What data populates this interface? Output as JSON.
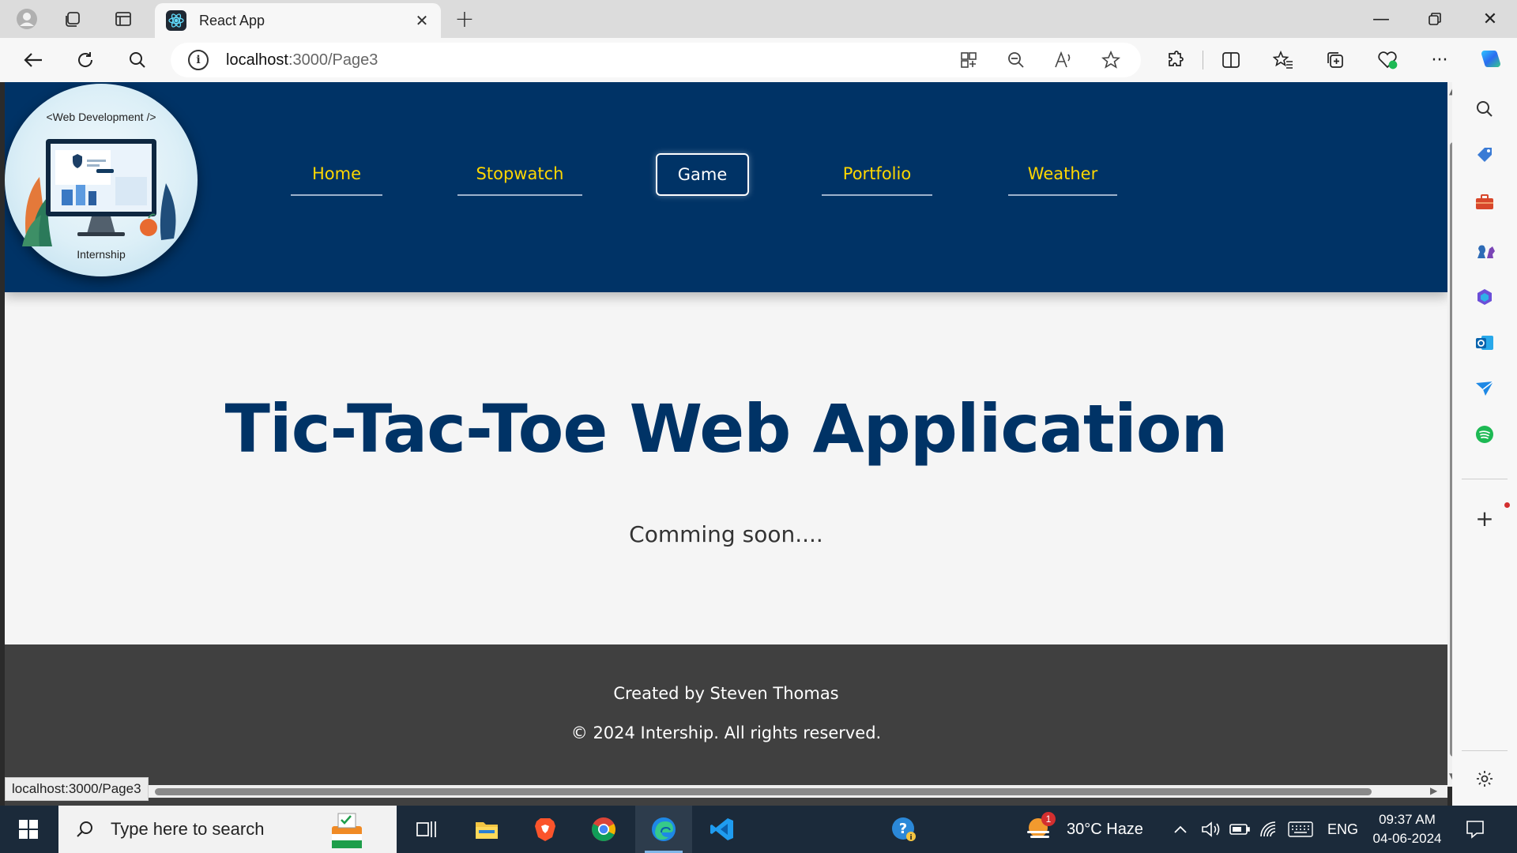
{
  "browser": {
    "tab_title": "React App",
    "url_host": "localhost",
    "url_path": ":3000/Page3",
    "status_url": "localhost:3000/Page3"
  },
  "site": {
    "logo_top_text": "<Web Development />",
    "logo_bottom_text": "Internship",
    "nav": [
      {
        "label": "Home",
        "active": false
      },
      {
        "label": "Stopwatch",
        "active": false
      },
      {
        "label": "Game",
        "active": true
      },
      {
        "label": "Portfolio",
        "active": false
      },
      {
        "label": "Weather",
        "active": false
      }
    ],
    "title": "Tic-Tac-Toe Web Application",
    "subtitle": "Comming soon....",
    "footer": {
      "created_by": "Created by Steven Thomas",
      "copyright": "© 2024 Intership. All rights reserved."
    }
  },
  "taskbar": {
    "search_placeholder": "Type here to search",
    "weather": "30°C  Haze",
    "weather_badge": "1",
    "language": "ENG",
    "time": "09:37 AM",
    "date": "04-06-2024"
  },
  "colors": {
    "header_bg": "#003366",
    "nav_link": "#ffd700",
    "footer_bg": "#404040",
    "page_bg": "#f5f5f5"
  }
}
